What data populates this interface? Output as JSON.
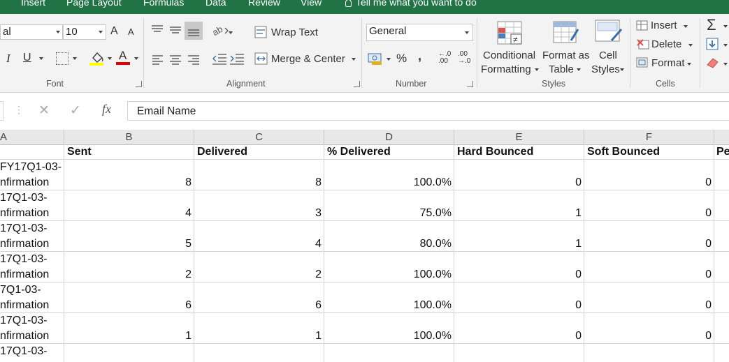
{
  "ribbon_tabs": [
    "Insert",
    "Page Layout",
    "Formulas",
    "Data",
    "Review",
    "View"
  ],
  "tell_me": "Tell me what you want to do",
  "font": {
    "family_value": "al",
    "size_value": "10",
    "group_label": "Font",
    "bold_italic": {
      "italic": "I",
      "underline": "U"
    },
    "grow": "A",
    "shrink": "A",
    "font_color_letter": "A"
  },
  "alignment": {
    "wrap_text": "Wrap Text",
    "merge_center": "Merge & Center",
    "group_label": "Alignment"
  },
  "number": {
    "format_value": "General",
    "percent": "%",
    "comma": ",",
    "inc_decimal": "←.0 .00",
    "dec_decimal": ".00 →.0",
    "group_label": "Number"
  },
  "styles": {
    "conditional": "Conditional",
    "formatting": "Formatting",
    "format_as": "Format as",
    "table": "Table",
    "cell": "Cell",
    "styles_label": "Styles",
    "group_label": "Styles"
  },
  "cells": {
    "insert": "Insert",
    "delete": "Delete",
    "format": "Format",
    "group_label": "Cells"
  },
  "editing": {
    "sum": "Σ"
  },
  "formula_bar": {
    "cancel": "✕",
    "enter": "✓",
    "fx": "fx",
    "value": "Email Name"
  },
  "columns": [
    "A",
    "B",
    "C",
    "D",
    "E",
    "F"
  ],
  "headers": [
    "Sent",
    "Delivered",
    "% Delivered",
    "Hard Bounced",
    "Soft Bounced",
    "Pe"
  ],
  "rows": [
    {
      "a1": "FY17Q1-03-",
      "a2": "nfirmation",
      "sent": "8",
      "delivered": "8",
      "pct": "100.0%",
      "hard": "0",
      "soft": "0"
    },
    {
      "a1": "17Q1-03-",
      "a2": "nfirmation",
      "sent": "4",
      "delivered": "3",
      "pct": "75.0%",
      "hard": "1",
      "soft": "0"
    },
    {
      "a1": "17Q1-03-",
      "a2": "nfirmation",
      "sent": "5",
      "delivered": "4",
      "pct": "80.0%",
      "hard": "1",
      "soft": "0"
    },
    {
      "a1": "17Q1-03-",
      "a2": "nfirmation",
      "sent": "2",
      "delivered": "2",
      "pct": "100.0%",
      "hard": "0",
      "soft": "0"
    },
    {
      "a1": "7Q1-03-",
      "a2": "nfirmation",
      "sent": "6",
      "delivered": "6",
      "pct": "100.0%",
      "hard": "0",
      "soft": "0"
    },
    {
      "a1": "17Q1-03-",
      "a2": "nfirmation",
      "sent": "1",
      "delivered": "1",
      "pct": "100.0%",
      "hard": "0",
      "soft": "0"
    },
    {
      "a1": "17Q1-03-",
      "a2": "",
      "sent": "",
      "delivered": "",
      "pct": "",
      "hard": "",
      "soft": ""
    }
  ],
  "colors": {
    "ribbon_green": "#217346",
    "highlight_yellow": "#ffff00",
    "font_red": "#e00000"
  }
}
